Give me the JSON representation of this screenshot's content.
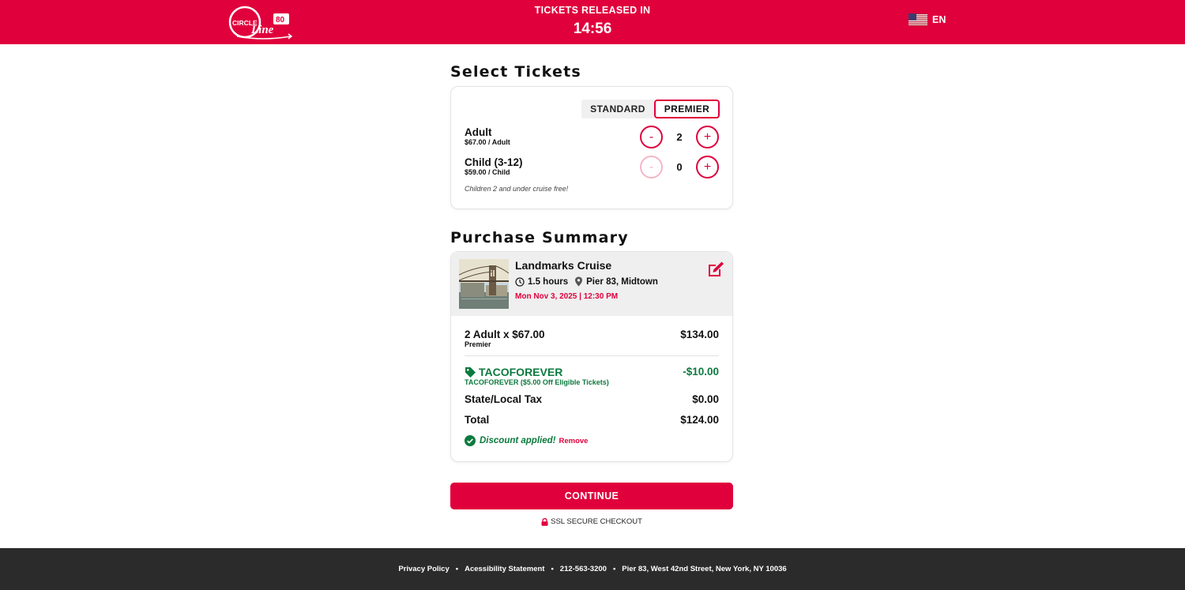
{
  "header": {
    "logo_text_circle": "CIRCLE",
    "logo_text_line": "Line",
    "logo_badge": "80",
    "countdown_label": "TICKETS RELEASED IN",
    "countdown_time": "14:56",
    "language": "EN",
    "brand_color": "#e0003c"
  },
  "tickets": {
    "title": "Select Tickets",
    "tab_standard": "STANDARD",
    "tab_premier": "PREMIER",
    "selected_tab": "PREMIER",
    "rows": [
      {
        "name": "Adult",
        "price": "$67.00 / Adult",
        "minus": "-",
        "plus": "+",
        "qty": "2"
      },
      {
        "name": "Child (3-12)",
        "price": "$59.00 / Child",
        "minus": "-",
        "plus": "+",
        "qty": "0"
      }
    ],
    "free_note": "Children 2 and under cruise free!"
  },
  "summary": {
    "title": "Purchase Summary",
    "cruise_name": "Landmarks Cruise",
    "duration": "1.5 hours",
    "location": "Pier 83, Midtown",
    "datetime": "Mon Nov 3, 2025 | 12:30 PM",
    "line_item": "2 Adult x $67.00",
    "line_item_tier": "Premier",
    "line_item_amount": "$134.00",
    "promo_code": "TACOFOREVER",
    "promo_desc": "TACOFOREVER ($5.00 Off Eligible Tickets)",
    "promo_amount": "-$10.00",
    "tax_label": "State/Local Tax",
    "tax_amount": "$0.00",
    "total_label": "Total",
    "total_amount": "$124.00",
    "discount_msg": "Discount applied!",
    "remove_label": "Remove"
  },
  "actions": {
    "continue_label": "CONTINUE",
    "ssl_label": "SSL SECURE CHECKOUT"
  },
  "footer": {
    "privacy": "Privacy Policy",
    "accessibility": "Acessibility Statement",
    "phone": "212-563-3200",
    "address": "Pier 83, West 42nd Street, New York, NY 10036",
    "separator": "•"
  },
  "icons": [
    "circle-line-logo",
    "us-flag-icon",
    "clock-icon",
    "map-pin-icon",
    "edit-icon",
    "tag-icon",
    "check-circle-icon",
    "lock-icon"
  ]
}
